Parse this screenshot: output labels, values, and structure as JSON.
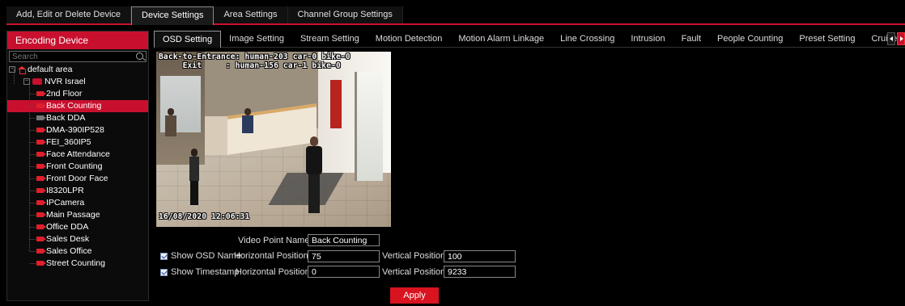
{
  "top_tabs": [
    "Add, Edit or Delete Device",
    "Device Settings",
    "Area Settings",
    "Channel Group Settings"
  ],
  "left_panel": {
    "title": "Encoding Device",
    "search_placeholder": "Search",
    "root": "default area",
    "nvr": "NVR Israel",
    "devices": [
      {
        "name": "2nd Floor",
        "online": true
      },
      {
        "name": "Back Counting",
        "online": true,
        "selected": true
      },
      {
        "name": "Back DDA",
        "online": false
      },
      {
        "name": "DMA-390IP528",
        "online": true
      },
      {
        "name": "FEI_360IP5",
        "online": true
      },
      {
        "name": "Face Attendance",
        "online": true
      },
      {
        "name": "Front Counting",
        "online": true
      },
      {
        "name": "Front Door Face",
        "online": true
      },
      {
        "name": "I8320LPR",
        "online": true
      },
      {
        "name": "IPCamera",
        "online": true
      },
      {
        "name": "Main Passage",
        "online": true
      },
      {
        "name": "Office DDA",
        "online": true
      },
      {
        "name": "Sales Desk",
        "online": true
      },
      {
        "name": "Sales Office",
        "online": true
      },
      {
        "name": "Street Counting",
        "online": true
      }
    ]
  },
  "sub_tabs": [
    "OSD Setting",
    "Image Setting",
    "Stream Setting",
    "Motion Detection",
    "Motion Alarm Linkage",
    "Line Crossing",
    "Intrusion",
    "Fault",
    "People Counting",
    "Preset Setting",
    "Cruise Settin"
  ],
  "video": {
    "osd_line1": "Back-to-Entrance: human-203 car-0 bike-0",
    "osd_line2": "     Exit     : human-156 car-1 bike-0",
    "timestamp": "16/08/2020 12:06:31"
  },
  "form": {
    "video_point_name_label": "Video Point Name",
    "video_point_name_value": "Back Counting",
    "show_osd_name_label": "Show OSD Name",
    "show_timestamp_label": "Show Timestamp",
    "horizontal_position_label": "Horizontal Position",
    "vertical_position_label": "Vertical Position",
    "osd_h": "75",
    "osd_v": "100",
    "ts_h": "0",
    "ts_v": "9233",
    "apply_label": "Apply"
  },
  "colors": {
    "accent": "#c8102e",
    "background": "#000000"
  }
}
